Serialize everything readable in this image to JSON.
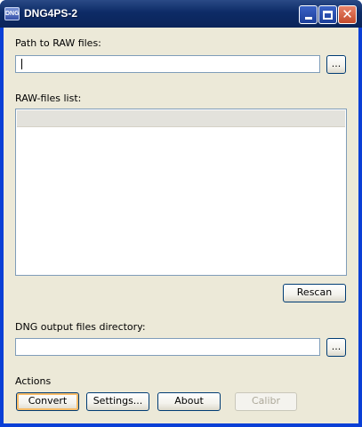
{
  "window": {
    "title": "DNG4PS-2",
    "icon_label": "DNG",
    "close_symbol": "✕"
  },
  "path_section": {
    "label": "Path to RAW files:",
    "value": "",
    "browse_label": "..."
  },
  "list_section": {
    "label": "RAW-files list:",
    "items": [],
    "rescan_label": "Rescan"
  },
  "output_section": {
    "label": "DNG output files directory:",
    "value": "",
    "browse_label": "..."
  },
  "actions": {
    "label": "Actions",
    "convert_label": "Convert",
    "settings_label": "Settings...",
    "about_label": "About",
    "calibr_label": "Calibr"
  },
  "colors": {
    "titlebar": "#0d2b66",
    "client_bg": "#ece9d8",
    "input_border": "#7f9db9",
    "focus_ring": "#f7bc69"
  }
}
